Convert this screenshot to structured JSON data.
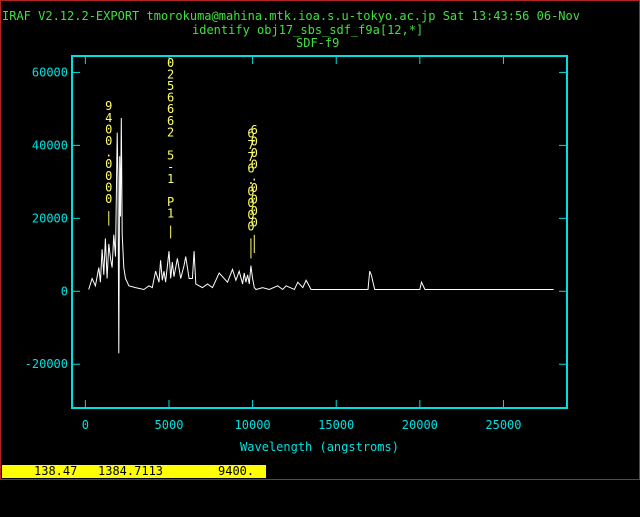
{
  "header": {
    "line1": "IRAF V2.12.2-EXPORT tmorokuma@mahina.mtk.ioa.s.u-tokyo.ac.jp Sat 13:43:56 06-Nov",
    "line2": "identify obj17_sbs_sdf_f9a[12,*]",
    "line3": "SDF-f9"
  },
  "status": {
    "a": "138.47",
    "b": "1384.7113",
    "c": "9400."
  },
  "colors": {
    "axis": "#00e0e0",
    "spectrum": "#ffffff",
    "marker": "#ffff66",
    "header": "#40e040",
    "status_bg": "#ffff00",
    "frame": "#b22222"
  },
  "chart_data": {
    "type": "line",
    "title": "SDF-f9",
    "xlabel": "Wavelength (angstroms)",
    "ylabel": "",
    "xlim": [
      -800,
      28800
    ],
    "ylim": [
      -32000,
      64500
    ],
    "xticks": [
      0,
      5000,
      10000,
      15000,
      20000,
      25000
    ],
    "xtick_labels": [
      "0",
      "5000",
      "10000",
      "15000",
      "20000",
      "25000"
    ],
    "yticks": [
      -20000,
      0,
      20000,
      40000,
      60000
    ],
    "ytick_labels": [
      "-20000",
      "0",
      "20000",
      "40000",
      "60000"
    ],
    "grid": false,
    "series": [
      {
        "values_x": [
          200,
          400,
          600,
          800,
          900,
          1000,
          1100,
          1200,
          1300,
          1400,
          1500,
          1600,
          1700,
          1800,
          1900,
          1950,
          2000,
          2050,
          2100,
          2150,
          2200,
          2300,
          2400,
          2600,
          3000,
          3500,
          3800,
          4000,
          4200,
          4400,
          4500,
          4600,
          4700,
          4800,
          5000,
          5100,
          5200,
          5300,
          5500,
          5700,
          5900,
          6000,
          6200,
          6400,
          6500,
          6600,
          6800,
          7000,
          7300,
          7600,
          8000,
          8500,
          8800,
          9000,
          9200,
          9400,
          9500,
          9600,
          9700,
          9800,
          9900,
          10000,
          10100,
          10200,
          10600,
          11000,
          11500,
          11800,
          12000,
          12500,
          12700,
          13000,
          13200,
          13500,
          14000,
          15000,
          16000,
          16500,
          16900,
          17000,
          17100,
          17300,
          18000,
          19000,
          20000,
          20100,
          20300,
          21000,
          23000,
          25000,
          27000,
          28000
        ],
        "values_y": [
          500,
          3500,
          1500,
          6500,
          2500,
          11500,
          4500,
          14500,
          3500,
          13000,
          9000,
          6500,
          15500,
          9500,
          43500,
          30500,
          -17000,
          37000,
          20500,
          47500,
          15500,
          6500,
          3500,
          1500,
          1000,
          500,
          1500,
          1000,
          5500,
          2500,
          8500,
          3000,
          5500,
          2500,
          11000,
          3500,
          8000,
          4000,
          9000,
          3500,
          7000,
          9500,
          3500,
          3500,
          11000,
          2000,
          1500,
          1000,
          2000,
          1000,
          5000,
          2500,
          6000,
          3000,
          5500,
          2000,
          5000,
          2500,
          4500,
          2000,
          7000,
          3500,
          1000,
          500,
          1000,
          500,
          1500,
          500,
          1500,
          500,
          2500,
          1000,
          3000,
          500,
          500,
          500,
          500,
          500,
          500,
          5500,
          4500,
          500,
          500,
          500,
          500,
          2500,
          500,
          500,
          500,
          500,
          500,
          500
        ]
      }
    ],
    "annotations": [
      {
        "x": 1400,
        "text": "9400.0000",
        "tick_low": 18000,
        "tick_high": 22000
      },
      {
        "x": 5100,
        "text": "0256662 5-1 P1",
        "tick_low": 14500,
        "tick_high": 18000
      },
      {
        "x": 9900,
        "text": "6776.0000",
        "tick_low": 9000,
        "tick_high": 14500
      },
      {
        "x": 10100,
        "text": "6000.0000",
        "tick_low": 10500,
        "tick_high": 15500
      }
    ]
  }
}
